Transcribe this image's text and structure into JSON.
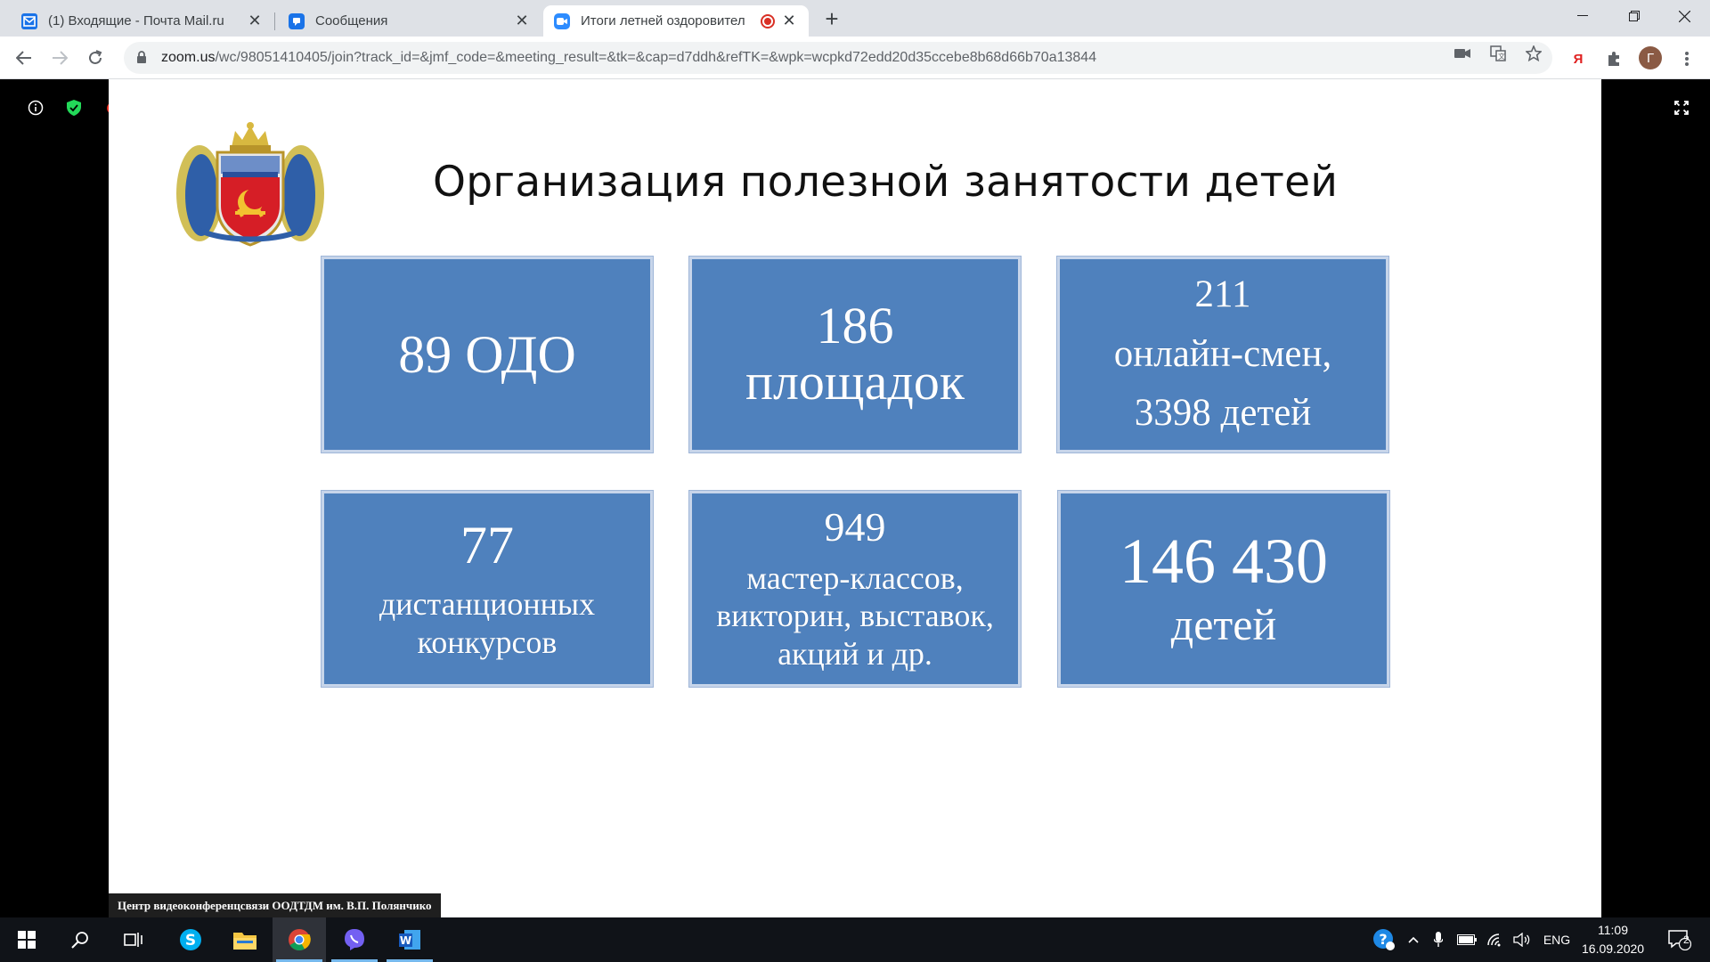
{
  "browser": {
    "tabs": [
      {
        "title": "(1) Входящие - Почта Mail.ru",
        "icon": "mail-icon",
        "active": false
      },
      {
        "title": "Сообщения",
        "icon": "chat-icon",
        "active": false
      },
      {
        "title": "Итоги летней оздоровител",
        "icon": "zoom-icon",
        "active": true,
        "recording": true
      }
    ],
    "new_tab_label": "+",
    "url_host": "zoom.us",
    "url_path": "/wc/98051410405/join?track_id=&jmf_code=&meeting_result=&tk=&cap=d7ddh&refTK=&wpk=wcpkd72edd20d35ccebe8b68d66b70a13844",
    "profile_initial": "Г",
    "yandex_label": "Я"
  },
  "slide": {
    "title": "Организация полезной занятости детей",
    "stats": [
      {
        "lines": [
          "89 ОДО"
        ]
      },
      {
        "lines": [
          "186",
          "площадок"
        ]
      },
      {
        "lines": [
          "211",
          "онлайн-смен,",
          "3398 детей"
        ]
      },
      {
        "lines": [
          "77",
          "дистанционных",
          "конкурсов"
        ]
      },
      {
        "lines": [
          "949",
          "мастер-классов,",
          "викторин, выставок,",
          "акций и др."
        ]
      },
      {
        "lines": [
          "146 430",
          "детей"
        ]
      }
    ]
  },
  "meeting": {
    "caption": "Центр видеоконференцсвязи ООДТДМ им. В.П. Полянчико"
  },
  "taskbar": {
    "language": "ENG",
    "time": "11:09",
    "date": "16.09.2020",
    "notifications": "2"
  },
  "colors": {
    "stat_box": "#4f81bd",
    "tab_strip": "#dee1e6",
    "taskbar": "#101318",
    "accent": "#76b9ed"
  }
}
